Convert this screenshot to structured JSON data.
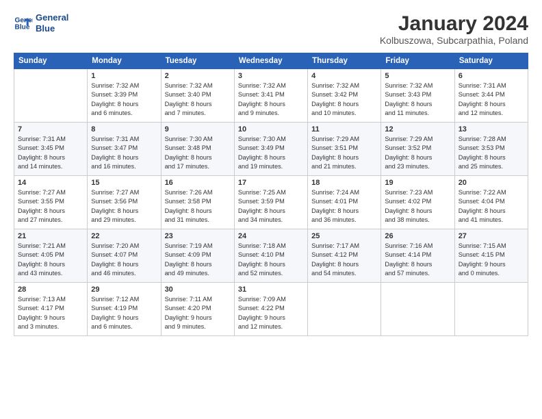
{
  "logo": {
    "line1": "General",
    "line2": "Blue"
  },
  "header": {
    "title": "January 2024",
    "subtitle": "Kolbuszowa, Subcarpathia, Poland"
  },
  "columns": [
    "Sunday",
    "Monday",
    "Tuesday",
    "Wednesday",
    "Thursday",
    "Friday",
    "Saturday"
  ],
  "weeks": [
    [
      {
        "day": "",
        "info": ""
      },
      {
        "day": "1",
        "info": "Sunrise: 7:32 AM\nSunset: 3:39 PM\nDaylight: 8 hours\nand 6 minutes."
      },
      {
        "day": "2",
        "info": "Sunrise: 7:32 AM\nSunset: 3:40 PM\nDaylight: 8 hours\nand 7 minutes."
      },
      {
        "day": "3",
        "info": "Sunrise: 7:32 AM\nSunset: 3:41 PM\nDaylight: 8 hours\nand 9 minutes."
      },
      {
        "day": "4",
        "info": "Sunrise: 7:32 AM\nSunset: 3:42 PM\nDaylight: 8 hours\nand 10 minutes."
      },
      {
        "day": "5",
        "info": "Sunrise: 7:32 AM\nSunset: 3:43 PM\nDaylight: 8 hours\nand 11 minutes."
      },
      {
        "day": "6",
        "info": "Sunrise: 7:31 AM\nSunset: 3:44 PM\nDaylight: 8 hours\nand 12 minutes."
      }
    ],
    [
      {
        "day": "7",
        "info": "Sunrise: 7:31 AM\nSunset: 3:45 PM\nDaylight: 8 hours\nand 14 minutes."
      },
      {
        "day": "8",
        "info": "Sunrise: 7:31 AM\nSunset: 3:47 PM\nDaylight: 8 hours\nand 16 minutes."
      },
      {
        "day": "9",
        "info": "Sunrise: 7:30 AM\nSunset: 3:48 PM\nDaylight: 8 hours\nand 17 minutes."
      },
      {
        "day": "10",
        "info": "Sunrise: 7:30 AM\nSunset: 3:49 PM\nDaylight: 8 hours\nand 19 minutes."
      },
      {
        "day": "11",
        "info": "Sunrise: 7:29 AM\nSunset: 3:51 PM\nDaylight: 8 hours\nand 21 minutes."
      },
      {
        "day": "12",
        "info": "Sunrise: 7:29 AM\nSunset: 3:52 PM\nDaylight: 8 hours\nand 23 minutes."
      },
      {
        "day": "13",
        "info": "Sunrise: 7:28 AM\nSunset: 3:53 PM\nDaylight: 8 hours\nand 25 minutes."
      }
    ],
    [
      {
        "day": "14",
        "info": "Sunrise: 7:27 AM\nSunset: 3:55 PM\nDaylight: 8 hours\nand 27 minutes."
      },
      {
        "day": "15",
        "info": "Sunrise: 7:27 AM\nSunset: 3:56 PM\nDaylight: 8 hours\nand 29 minutes."
      },
      {
        "day": "16",
        "info": "Sunrise: 7:26 AM\nSunset: 3:58 PM\nDaylight: 8 hours\nand 31 minutes."
      },
      {
        "day": "17",
        "info": "Sunrise: 7:25 AM\nSunset: 3:59 PM\nDaylight: 8 hours\nand 34 minutes."
      },
      {
        "day": "18",
        "info": "Sunrise: 7:24 AM\nSunset: 4:01 PM\nDaylight: 8 hours\nand 36 minutes."
      },
      {
        "day": "19",
        "info": "Sunrise: 7:23 AM\nSunset: 4:02 PM\nDaylight: 8 hours\nand 38 minutes."
      },
      {
        "day": "20",
        "info": "Sunrise: 7:22 AM\nSunset: 4:04 PM\nDaylight: 8 hours\nand 41 minutes."
      }
    ],
    [
      {
        "day": "21",
        "info": "Sunrise: 7:21 AM\nSunset: 4:05 PM\nDaylight: 8 hours\nand 43 minutes."
      },
      {
        "day": "22",
        "info": "Sunrise: 7:20 AM\nSunset: 4:07 PM\nDaylight: 8 hours\nand 46 minutes."
      },
      {
        "day": "23",
        "info": "Sunrise: 7:19 AM\nSunset: 4:09 PM\nDaylight: 8 hours\nand 49 minutes."
      },
      {
        "day": "24",
        "info": "Sunrise: 7:18 AM\nSunset: 4:10 PM\nDaylight: 8 hours\nand 52 minutes."
      },
      {
        "day": "25",
        "info": "Sunrise: 7:17 AM\nSunset: 4:12 PM\nDaylight: 8 hours\nand 54 minutes."
      },
      {
        "day": "26",
        "info": "Sunrise: 7:16 AM\nSunset: 4:14 PM\nDaylight: 8 hours\nand 57 minutes."
      },
      {
        "day": "27",
        "info": "Sunrise: 7:15 AM\nSunset: 4:15 PM\nDaylight: 9 hours\nand 0 minutes."
      }
    ],
    [
      {
        "day": "28",
        "info": "Sunrise: 7:13 AM\nSunset: 4:17 PM\nDaylight: 9 hours\nand 3 minutes."
      },
      {
        "day": "29",
        "info": "Sunrise: 7:12 AM\nSunset: 4:19 PM\nDaylight: 9 hours\nand 6 minutes."
      },
      {
        "day": "30",
        "info": "Sunrise: 7:11 AM\nSunset: 4:20 PM\nDaylight: 9 hours\nand 9 minutes."
      },
      {
        "day": "31",
        "info": "Sunrise: 7:09 AM\nSunset: 4:22 PM\nDaylight: 9 hours\nand 12 minutes."
      },
      {
        "day": "",
        "info": ""
      },
      {
        "day": "",
        "info": ""
      },
      {
        "day": "",
        "info": ""
      }
    ]
  ]
}
